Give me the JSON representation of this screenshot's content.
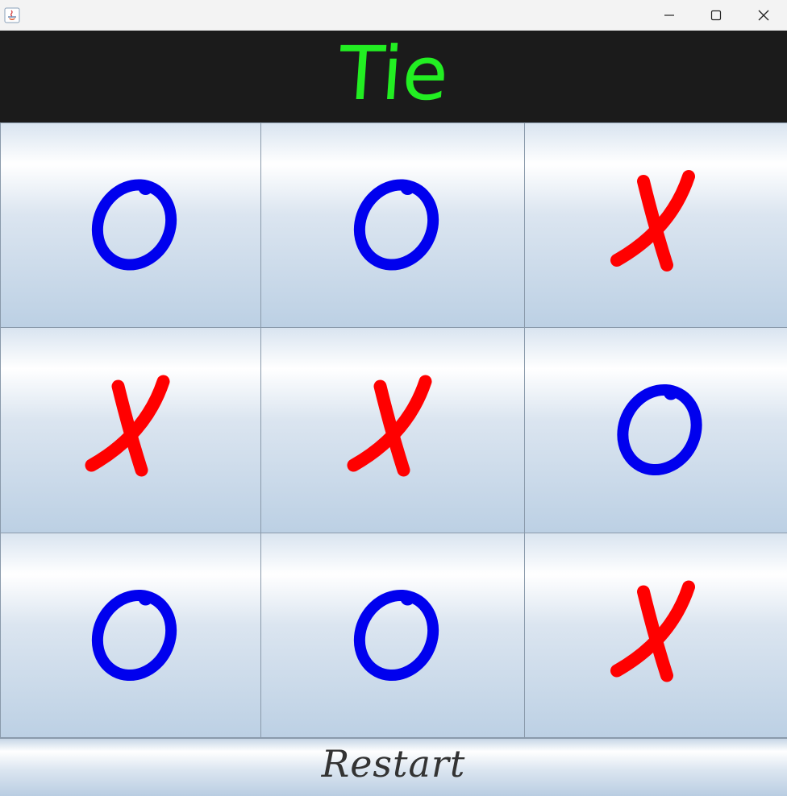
{
  "window": {
    "app_icon": "java-icon",
    "controls": [
      "minimize-icon",
      "maximize-icon",
      "close-icon"
    ]
  },
  "status": {
    "text": "Tie",
    "color": "#22ee22",
    "background": "#1b1b1b"
  },
  "board": {
    "cells": [
      "O",
      "O",
      "X",
      "X",
      "X",
      "O",
      "O",
      "O",
      "X"
    ],
    "x_color": "#ff0000",
    "o_color": "#0000ee"
  },
  "restart": {
    "label": "Restart"
  }
}
